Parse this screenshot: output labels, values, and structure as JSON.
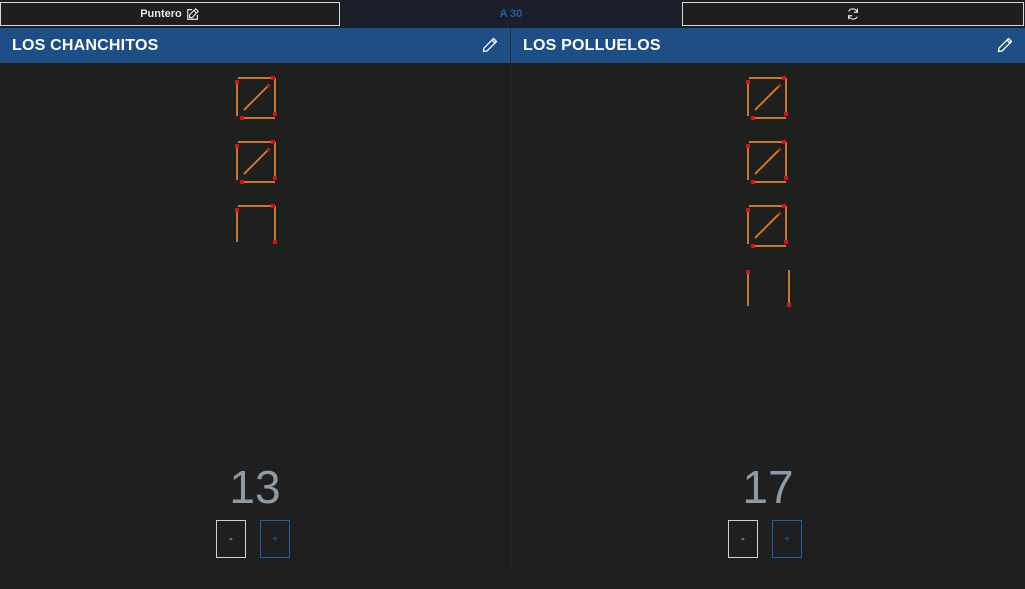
{
  "toolbar": {
    "pointer_label": "Puntero",
    "target_label": "A 30"
  },
  "teams": [
    {
      "name": "LOS CHANCHITOS",
      "score": "13",
      "minus_label": "-",
      "plus_label": "+"
    },
    {
      "name": "LOS POLLUELOS",
      "score": "17",
      "minus_label": "-",
      "plus_label": "+"
    }
  ],
  "colors": {
    "header_blue": "#1d4f86",
    "accent_blue": "#1e5fa8",
    "match_stick": "#c9762f",
    "match_head": "#d0121a"
  },
  "icons": [
    "edit-icon",
    "pencil-icon",
    "refresh-icon"
  ]
}
